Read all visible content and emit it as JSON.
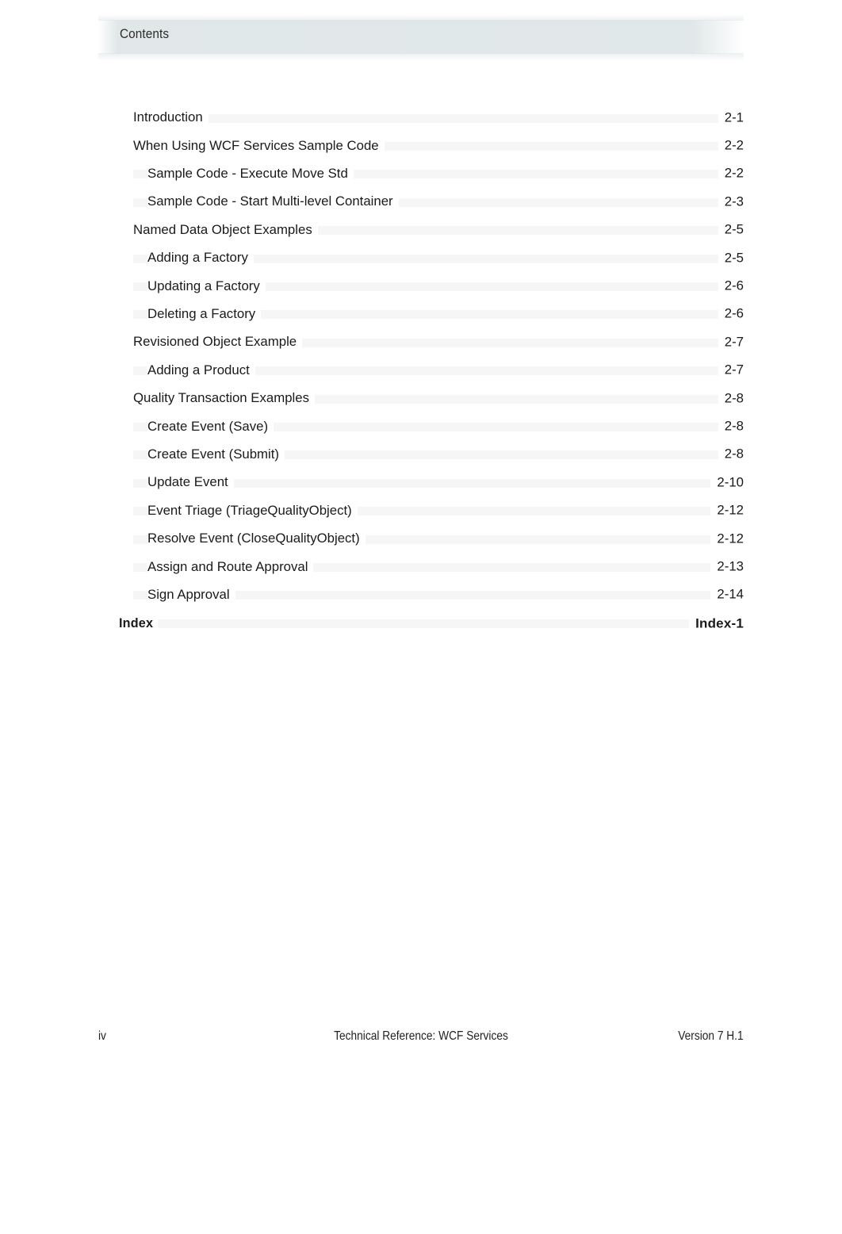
{
  "header": {
    "title": "Contents"
  },
  "toc": {
    "entries": [
      {
        "label": "Introduction",
        "page": "2-1",
        "level": 1
      },
      {
        "label": "When Using WCF Services Sample Code",
        "page": "2-2",
        "level": 1
      },
      {
        "label": "Sample Code - Execute Move Std",
        "page": "2-2",
        "level": 2
      },
      {
        "label": "Sample Code - Start Multi-level Container",
        "page": "2-3",
        "level": 2
      },
      {
        "label": "Named Data Object Examples",
        "page": "2-5",
        "level": 1
      },
      {
        "label": "Adding a Factory",
        "page": "2-5",
        "level": 2
      },
      {
        "label": "Updating a Factory",
        "page": "2-6",
        "level": 2
      },
      {
        "label": "Deleting a Factory",
        "page": "2-6",
        "level": 2
      },
      {
        "label": "Revisioned Object Example",
        "page": "2-7",
        "level": 1
      },
      {
        "label": "Adding a Product",
        "page": "2-7",
        "level": 2
      },
      {
        "label": "Quality Transaction Examples",
        "page": "2-8",
        "level": 1
      },
      {
        "label": "Create Event (Save)",
        "page": "2-8",
        "level": 2
      },
      {
        "label": "Create Event (Submit)",
        "page": "2-8",
        "level": 2
      },
      {
        "label": "Update Event",
        "page": "2-10",
        "level": 2
      },
      {
        "label": "Event Triage (TriageQualityObject)",
        "page": "2-12",
        "level": 2
      },
      {
        "label": "Resolve Event (CloseQualityObject)",
        "page": "2-12",
        "level": 2
      },
      {
        "label": "Assign and Route Approval",
        "page": "2-13",
        "level": 2
      },
      {
        "label": "Sign Approval",
        "page": "2-14",
        "level": 2
      },
      {
        "label": "Index",
        "page": "Index-1",
        "level": "index"
      }
    ]
  },
  "footer": {
    "page_number": "iv",
    "document_title": "Technical Reference: WCF Services",
    "version": "Version 7 H.1"
  },
  "colors": {
    "header_band": "#dfe6e7",
    "text": "#1a1a1a",
    "leader": "#f6f6f6",
    "page_background": "#ffffff"
  }
}
